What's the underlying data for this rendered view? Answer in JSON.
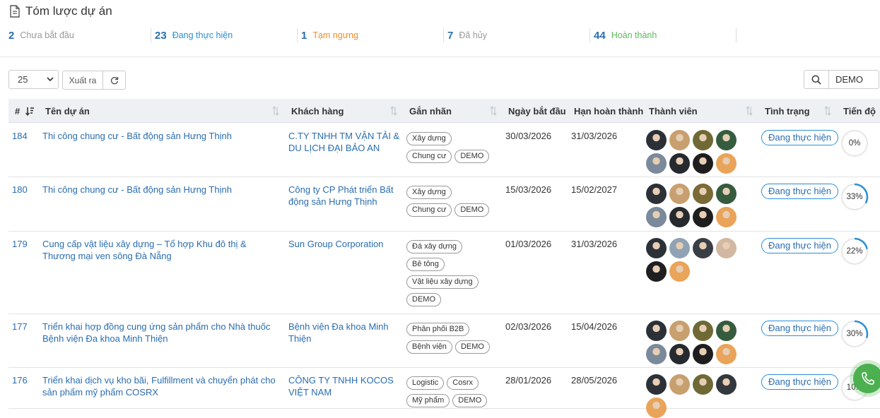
{
  "summary": {
    "title": "Tóm lược dự án",
    "stats": [
      {
        "count": "2",
        "label": "Chưa bắt đầu",
        "color": "#999999"
      },
      {
        "count": "23",
        "label": "Đang thực hiện",
        "color": "#2a8fd6"
      },
      {
        "count": "1",
        "label": "Tạm ngưng",
        "color": "#f08c28"
      },
      {
        "count": "7",
        "label": "Đã hủy",
        "color": "#999999"
      },
      {
        "count": "44",
        "label": "Hoàn thành",
        "color": "#5cb85c"
      }
    ]
  },
  "toolbar": {
    "page_size": "25",
    "export_label": "Xuất ra",
    "search_value": "DEMO",
    "refresh_icon": "refresh-icon",
    "search_icon": "search-icon"
  },
  "table": {
    "headers": {
      "id": "#",
      "name": "Tên dự án",
      "client": "Khách hàng",
      "tags": "Gắn nhãn",
      "start": "Ngày bắt đầu",
      "deadline": "Hạn hoàn thành",
      "members": "Thành viên",
      "status": "Tình trạng",
      "progress": "Tiến độ"
    },
    "rows": [
      {
        "id": "184",
        "name": "Thi công chung cư - Bất động sản Hưng Thịnh",
        "client": "C.TY TNHH TM VẬN TẢI & DU LỊCH ĐẠI BẢO AN",
        "tags": [
          "Xây dựng",
          "Chung cư",
          "DEMO"
        ],
        "start": "30/03/2026",
        "deadline": "31/03/2026",
        "member_count": 8,
        "status": "Đang thực hiện",
        "progress_label": "0%",
        "progress": 0
      },
      {
        "id": "180",
        "name": "Thi công chung cư - Bất động sản Hưng Thịnh",
        "client": "Công ty CP Phát triển Bất động sản Hưng Thịnh",
        "tags": [
          "Xây dựng",
          "Chung cư",
          "DEMO"
        ],
        "start": "15/03/2026",
        "deadline": "15/02/2027",
        "member_count": 8,
        "status": "Đang thực hiện",
        "progress_label": "33%",
        "progress": 33
      },
      {
        "id": "179",
        "name": "Cung cấp vật liệu xây dựng – Tổ hợp Khu đô thị & Thương mại ven sông Đà Nẵng",
        "client": "Sun Group Corporation",
        "tags": [
          "Đá xây dựng",
          "Bê tông",
          "Vật liệu xây dựng",
          "DEMO"
        ],
        "start": "01/03/2026",
        "deadline": "31/03/2026",
        "member_count": 6,
        "status": "Đang thực hiện",
        "progress_label": "22%",
        "progress": 22
      },
      {
        "id": "177",
        "name": "Triển khai hợp đồng cung ứng sản phẩm cho Nhà thuốc Bệnh viện Đa khoa Minh Thiện",
        "client": "Bệnh viện Đa khoa Minh Thiện",
        "tags": [
          "Phân phối B2B",
          "Bệnh viện",
          "DEMO"
        ],
        "start": "02/03/2026",
        "deadline": "15/04/2026",
        "member_count": 8,
        "status": "Đang thực hiện",
        "progress_label": "30%",
        "progress": 30
      },
      {
        "id": "176",
        "name": "Triển khai dịch vụ kho bãi, Fulfillment và chuyển phát cho sản phẩm mỹ phẩm COSRX",
        "client": "CÔNG TY TNHH KOCOS VIỆT NAM",
        "tags": [
          "Logistic",
          "Cosrx",
          "Mỹ phẩm",
          "DEMO"
        ],
        "start": "28/01/2026",
        "deadline": "28/05/2026",
        "member_count": 5,
        "status": "Đang thực hiện",
        "progress_label": "10...",
        "progress": 10
      }
    ]
  },
  "colors": {
    "accent": "#2a6db0",
    "status_border": "#2a8fd6",
    "header_bg": "#eef0f3",
    "fab": "#4caf50"
  },
  "fab_icon": "phone-icon"
}
